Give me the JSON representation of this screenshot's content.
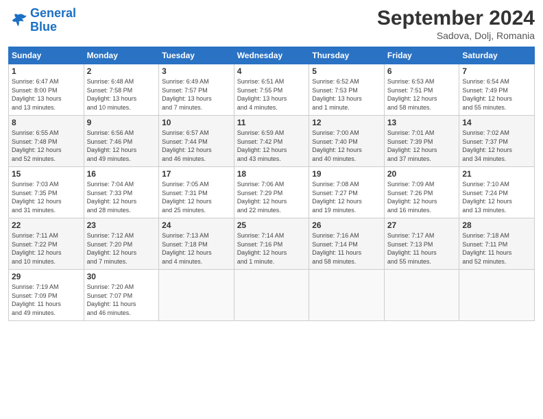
{
  "header": {
    "logo_text_general": "General",
    "logo_text_blue": "Blue",
    "month_title": "September 2024",
    "subtitle": "Sadova, Dolj, Romania"
  },
  "weekdays": [
    "Sunday",
    "Monday",
    "Tuesday",
    "Wednesday",
    "Thursday",
    "Friday",
    "Saturday"
  ],
  "weeks": [
    [
      {
        "day": "1",
        "info": "Sunrise: 6:47 AM\nSunset: 8:00 PM\nDaylight: 13 hours\nand 13 minutes."
      },
      {
        "day": "2",
        "info": "Sunrise: 6:48 AM\nSunset: 7:58 PM\nDaylight: 13 hours\nand 10 minutes."
      },
      {
        "day": "3",
        "info": "Sunrise: 6:49 AM\nSunset: 7:57 PM\nDaylight: 13 hours\nand 7 minutes."
      },
      {
        "day": "4",
        "info": "Sunrise: 6:51 AM\nSunset: 7:55 PM\nDaylight: 13 hours\nand 4 minutes."
      },
      {
        "day": "5",
        "info": "Sunrise: 6:52 AM\nSunset: 7:53 PM\nDaylight: 13 hours\nand 1 minute."
      },
      {
        "day": "6",
        "info": "Sunrise: 6:53 AM\nSunset: 7:51 PM\nDaylight: 12 hours\nand 58 minutes."
      },
      {
        "day": "7",
        "info": "Sunrise: 6:54 AM\nSunset: 7:49 PM\nDaylight: 12 hours\nand 55 minutes."
      }
    ],
    [
      {
        "day": "8",
        "info": "Sunrise: 6:55 AM\nSunset: 7:48 PM\nDaylight: 12 hours\nand 52 minutes."
      },
      {
        "day": "9",
        "info": "Sunrise: 6:56 AM\nSunset: 7:46 PM\nDaylight: 12 hours\nand 49 minutes."
      },
      {
        "day": "10",
        "info": "Sunrise: 6:57 AM\nSunset: 7:44 PM\nDaylight: 12 hours\nand 46 minutes."
      },
      {
        "day": "11",
        "info": "Sunrise: 6:59 AM\nSunset: 7:42 PM\nDaylight: 12 hours\nand 43 minutes."
      },
      {
        "day": "12",
        "info": "Sunrise: 7:00 AM\nSunset: 7:40 PM\nDaylight: 12 hours\nand 40 minutes."
      },
      {
        "day": "13",
        "info": "Sunrise: 7:01 AM\nSunset: 7:39 PM\nDaylight: 12 hours\nand 37 minutes."
      },
      {
        "day": "14",
        "info": "Sunrise: 7:02 AM\nSunset: 7:37 PM\nDaylight: 12 hours\nand 34 minutes."
      }
    ],
    [
      {
        "day": "15",
        "info": "Sunrise: 7:03 AM\nSunset: 7:35 PM\nDaylight: 12 hours\nand 31 minutes."
      },
      {
        "day": "16",
        "info": "Sunrise: 7:04 AM\nSunset: 7:33 PM\nDaylight: 12 hours\nand 28 minutes."
      },
      {
        "day": "17",
        "info": "Sunrise: 7:05 AM\nSunset: 7:31 PM\nDaylight: 12 hours\nand 25 minutes."
      },
      {
        "day": "18",
        "info": "Sunrise: 7:06 AM\nSunset: 7:29 PM\nDaylight: 12 hours\nand 22 minutes."
      },
      {
        "day": "19",
        "info": "Sunrise: 7:08 AM\nSunset: 7:27 PM\nDaylight: 12 hours\nand 19 minutes."
      },
      {
        "day": "20",
        "info": "Sunrise: 7:09 AM\nSunset: 7:26 PM\nDaylight: 12 hours\nand 16 minutes."
      },
      {
        "day": "21",
        "info": "Sunrise: 7:10 AM\nSunset: 7:24 PM\nDaylight: 12 hours\nand 13 minutes."
      }
    ],
    [
      {
        "day": "22",
        "info": "Sunrise: 7:11 AM\nSunset: 7:22 PM\nDaylight: 12 hours\nand 10 minutes."
      },
      {
        "day": "23",
        "info": "Sunrise: 7:12 AM\nSunset: 7:20 PM\nDaylight: 12 hours\nand 7 minutes."
      },
      {
        "day": "24",
        "info": "Sunrise: 7:13 AM\nSunset: 7:18 PM\nDaylight: 12 hours\nand 4 minutes."
      },
      {
        "day": "25",
        "info": "Sunrise: 7:14 AM\nSunset: 7:16 PM\nDaylight: 12 hours\nand 1 minute."
      },
      {
        "day": "26",
        "info": "Sunrise: 7:16 AM\nSunset: 7:14 PM\nDaylight: 11 hours\nand 58 minutes."
      },
      {
        "day": "27",
        "info": "Sunrise: 7:17 AM\nSunset: 7:13 PM\nDaylight: 11 hours\nand 55 minutes."
      },
      {
        "day": "28",
        "info": "Sunrise: 7:18 AM\nSunset: 7:11 PM\nDaylight: 11 hours\nand 52 minutes."
      }
    ],
    [
      {
        "day": "29",
        "info": "Sunrise: 7:19 AM\nSunset: 7:09 PM\nDaylight: 11 hours\nand 49 minutes."
      },
      {
        "day": "30",
        "info": "Sunrise: 7:20 AM\nSunset: 7:07 PM\nDaylight: 11 hours\nand 46 minutes."
      },
      {
        "day": "",
        "info": ""
      },
      {
        "day": "",
        "info": ""
      },
      {
        "day": "",
        "info": ""
      },
      {
        "day": "",
        "info": ""
      },
      {
        "day": "",
        "info": ""
      }
    ]
  ]
}
